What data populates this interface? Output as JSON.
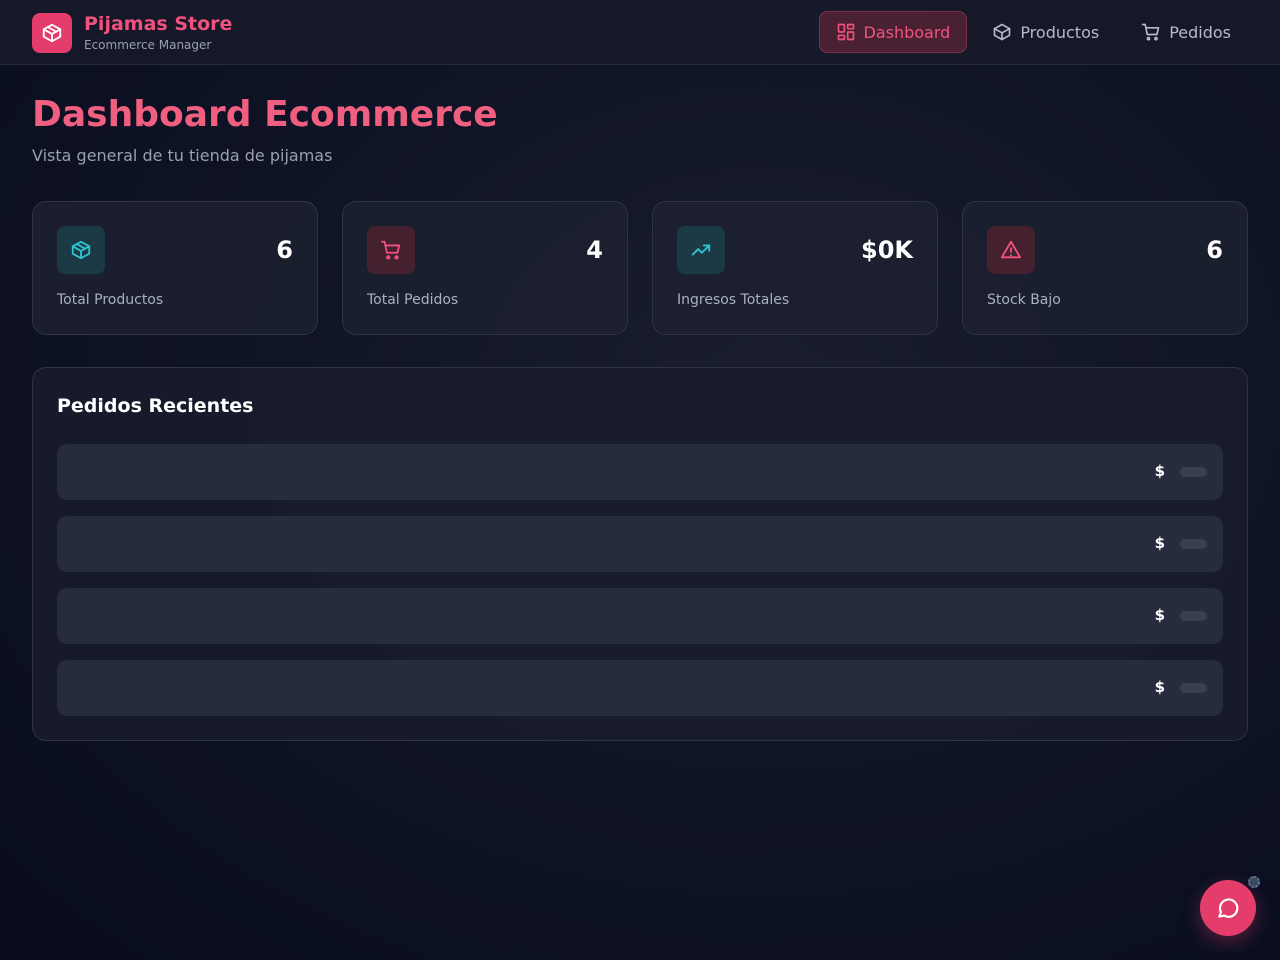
{
  "colors": {
    "accent": "#e43d6c",
    "accent_text": "#f0527d",
    "teal": "#2ec4d0",
    "background": "#0f1426"
  },
  "brand": {
    "title": "Pijamas Store",
    "subtitle": "Ecommerce Manager",
    "icon": "package-icon"
  },
  "nav": [
    {
      "label": "Dashboard",
      "icon": "dashboard-grid-icon",
      "active": true
    },
    {
      "label": "Productos",
      "icon": "package-icon",
      "active": false
    },
    {
      "label": "Pedidos",
      "icon": "cart-icon",
      "active": false
    }
  ],
  "page": {
    "title": "Dashboard Ecommerce",
    "subtitle": "Vista general de tu tienda de pijamas"
  },
  "stats": [
    {
      "value": "6",
      "label": "Total Productos",
      "icon": "package-icon"
    },
    {
      "value": "4",
      "label": "Total Pedidos",
      "icon": "cart-icon"
    },
    {
      "value": "$0K",
      "label": "Ingresos Totales",
      "icon": "trending-up-icon"
    },
    {
      "value": "6",
      "label": "Stock Bajo",
      "icon": "alert-triangle-icon"
    }
  ],
  "orders": {
    "title": "Pedidos Recientes",
    "rows": [
      {
        "amount": "$"
      },
      {
        "amount": "$"
      },
      {
        "amount": "$"
      },
      {
        "amount": "$"
      }
    ]
  },
  "chat": {
    "icon": "chat-bubble-icon"
  }
}
